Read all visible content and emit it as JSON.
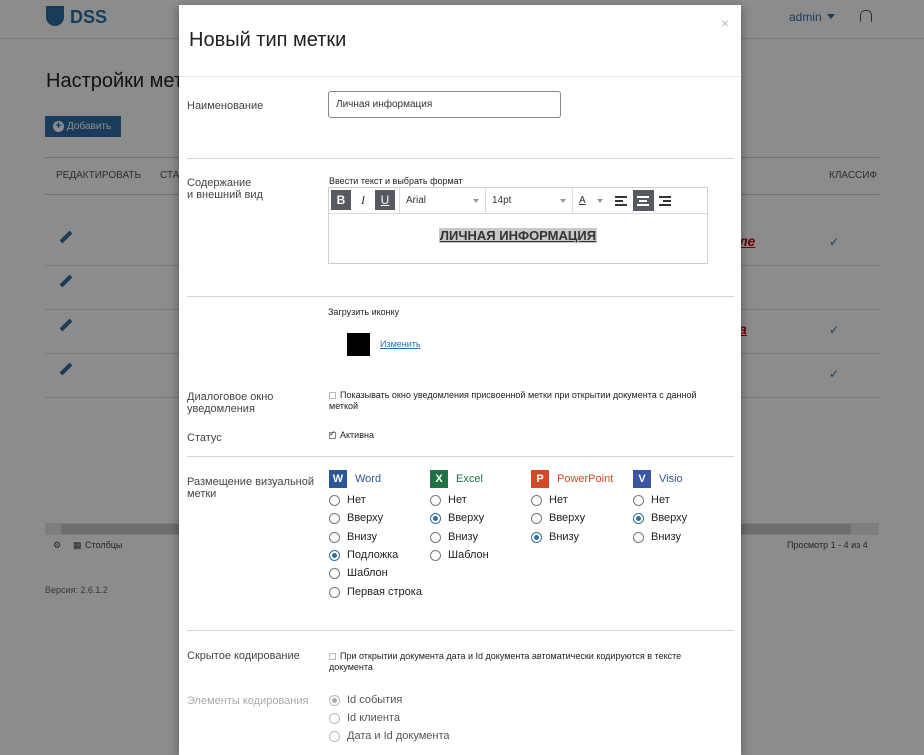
{
  "app": {
    "logo": "DSS",
    "user": "admin"
  },
  "page": {
    "title": "Настройки мет",
    "add_button": "Добавить",
    "columns": [
      "РЕДАКТИРОВАТЬ",
      "СТА",
      "КЛАССИФ"
    ],
    "footer_columns": "Столбцы",
    "footer_count": "Просмотр 1 - 4 из 4",
    "version": "Версия: 2.6.1.2",
    "row_fragment_1": "ле",
    "row_fragment_3": "а"
  },
  "modal": {
    "title": "Новый тип метки",
    "close": "×",
    "name_label": "Наименование",
    "name_value": "Личная информация",
    "content_label_1": "Содержание",
    "content_label_2": "и внешний вид",
    "editor_hint": "Ввести текст и выбрать формат",
    "toolbar": {
      "bold": "B",
      "italic": "I",
      "underline": "U",
      "font": "Arial",
      "size": "14pt",
      "font_color": "A"
    },
    "editor_text": "ЛИЧНАЯ ИНФОРМАЦИЯ",
    "upload_label": "Загрузить иконку",
    "change_link": "Изменить",
    "dialog_label_1": "Диалоговое окно",
    "dialog_label_2": "уведомления",
    "dialog_checkbox_1": "Показывать окно уведомления присвоенной метки при открытии документа с данной",
    "dialog_checkbox_2": "меткой",
    "status_label": "Статус",
    "status_checkbox": "Активна",
    "placement_label_1": "Размещение визуальной",
    "placement_label_2": "метки",
    "apps": [
      {
        "name": "Word",
        "color": "#2b5797",
        "icon": "W",
        "options": [
          "Нет",
          "Вверху",
          "Внизу",
          "Подложка",
          "Шаблон",
          "Первая строка"
        ],
        "selected": "Подложка"
      },
      {
        "name": "Excel",
        "color": "#207245",
        "icon": "X",
        "options": [
          "Нет",
          "Вверху",
          "Внизу",
          "Шаблон"
        ],
        "selected": "Вверху"
      },
      {
        "name": "PowerPoint",
        "color": "#d24726",
        "icon": "P",
        "options": [
          "Нет",
          "Вверху",
          "Внизу"
        ],
        "selected": "Внизу"
      },
      {
        "name": "Visio",
        "color": "#3955a3",
        "icon": "V",
        "options": [
          "Нет",
          "Вверху",
          "Внизу"
        ],
        "selected": "Вверху"
      }
    ],
    "hidden_label": "Скрытое кодирование",
    "hidden_checkbox_1": "При открытии документа дата и Id документа автоматически кодируются в тексте",
    "hidden_checkbox_2": "документа",
    "elements_label": "Элементы кодирования",
    "elements": [
      "Id события",
      "Id клиента",
      "Дата и Id документа"
    ],
    "elements_selected": "Id события"
  }
}
